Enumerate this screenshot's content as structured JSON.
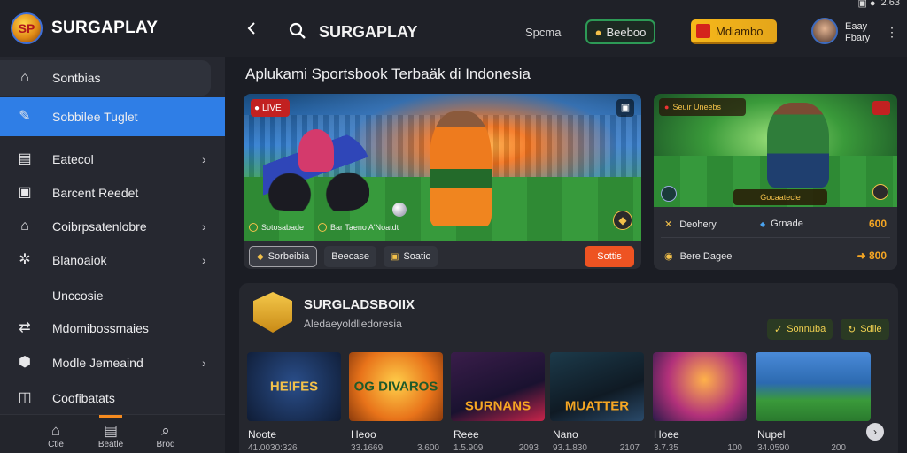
{
  "status_bar": {
    "time": "2.63"
  },
  "brand": {
    "logo_text": "SP",
    "name": "SURGAPLAY"
  },
  "header": {
    "title": "SURGAPLAY",
    "link": "Spcma",
    "pill_green": "Beeboo",
    "pill_yellow": "Mdiambo",
    "user_line1": "Eaay",
    "user_line2": "Fbary"
  },
  "sidebar": {
    "items": [
      {
        "label": "Sontbias",
        "icon": "home-icon",
        "chevron": false
      },
      {
        "label": "Sobbilee Tuglet",
        "icon": "ticket-icon",
        "chevron": false
      },
      {
        "label": "Eatecol",
        "icon": "calendar-icon",
        "chevron": true
      },
      {
        "label": "Barcent Reedet",
        "icon": "receipt-icon",
        "chevron": false
      },
      {
        "label": "Coibrpsatenlobre",
        "icon": "house-icon",
        "chevron": true
      },
      {
        "label": "Blanoaiok",
        "icon": "gear-icon",
        "chevron": true
      },
      {
        "label": "Unccosie",
        "icon": "",
        "chevron": false
      },
      {
        "label": "Mdomibossmaies",
        "icon": "swap-icon",
        "chevron": false
      },
      {
        "label": "Modle Jemeaind",
        "icon": "shield-icon",
        "chevron": true
      },
      {
        "label": "Coofibatats",
        "icon": "box-icon",
        "chevron": false
      }
    ]
  },
  "bottom_nav": [
    {
      "label": "Ctie",
      "icon": "home-icon"
    },
    {
      "label": "Beatle",
      "icon": "calendar-icon"
    },
    {
      "label": "Brod",
      "icon": "search-icon"
    }
  ],
  "main": {
    "section_title": "Aplukami Sportsbook Terbaäk di Indonesia",
    "hero": {
      "badge": "LIVE",
      "caption_left": "Sotosabade",
      "caption_right": "Bar Taeno A'Noatdt",
      "actions": [
        "Sorbeibia",
        "Beecase",
        "Soatic"
      ],
      "cta": "Sottis"
    },
    "side_card": {
      "badge": "Seuir Uneebs",
      "label": "Gocaatecle",
      "row1_left": "Deohery",
      "row1_mid": "Grnade",
      "row1_odds": "600",
      "row2_left": "Bere Dagee",
      "row2_odds": "800"
    },
    "section2": {
      "title": "SURGLADSBOIIX",
      "subtitle": "Aledaeyoldlledoresia",
      "chip1": "Sonnuba",
      "chip2": "Sdile",
      "tiles": [
        {
          "title": "HEIFES",
          "name": "Noote",
          "num_left": "41.0030:326",
          "num_right": ""
        },
        {
          "title": "OG DIVAROS",
          "name": "Heoo",
          "num_left": "33.1669",
          "num_right": "3.600"
        },
        {
          "title": "SURNANS",
          "name": "Reee",
          "num_left": "1.5.909",
          "num_right": "2093"
        },
        {
          "title": "MUATTER",
          "name": "Nano",
          "num_left": "93.1.830",
          "num_right": "2107"
        },
        {
          "title": "",
          "name": "Hoee",
          "num_left": "3.7.35",
          "num_right": "100"
        },
        {
          "title": "",
          "name": "Nupel",
          "num_left": "34.0590",
          "num_right": "200"
        }
      ]
    }
  }
}
